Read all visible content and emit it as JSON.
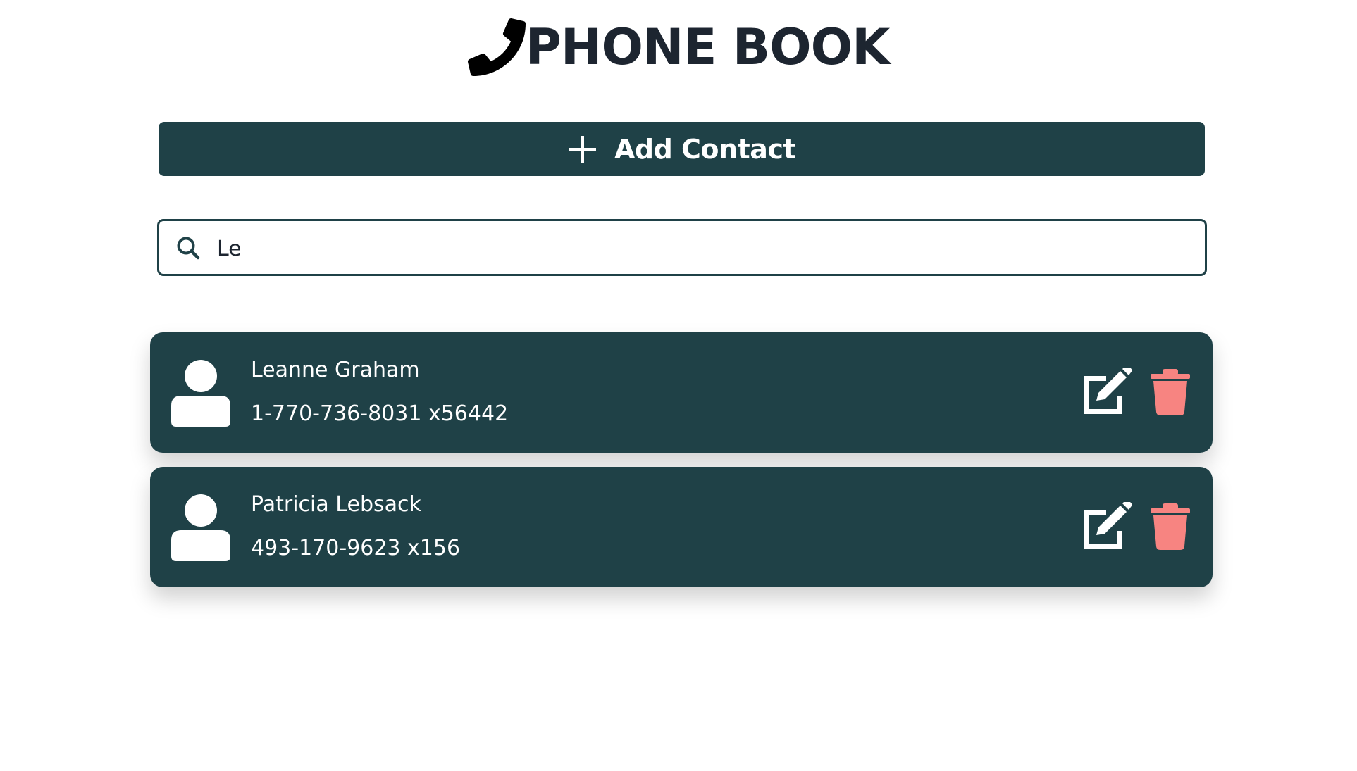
{
  "header": {
    "icon": "phone-icon",
    "title": "PHONE BOOK"
  },
  "add_button": {
    "icon": "plus-icon",
    "label": "Add Contact"
  },
  "search": {
    "icon": "search-icon",
    "value": "Le"
  },
  "contacts": [
    {
      "avatar_icon": "user-icon",
      "name": "Leanne Graham",
      "phone": "1-770-736-8031 x56442",
      "edit_icon": "edit-icon",
      "delete_icon": "trash-icon"
    },
    {
      "avatar_icon": "user-icon",
      "name": "Patricia Lebsack",
      "phone": "493-170-9623 x156",
      "edit_icon": "edit-icon",
      "delete_icon": "trash-icon"
    }
  ],
  "colors": {
    "primary": "#1f4147",
    "title": "#1d2530",
    "delete": "#f78481",
    "card_text": "#ffffff"
  }
}
